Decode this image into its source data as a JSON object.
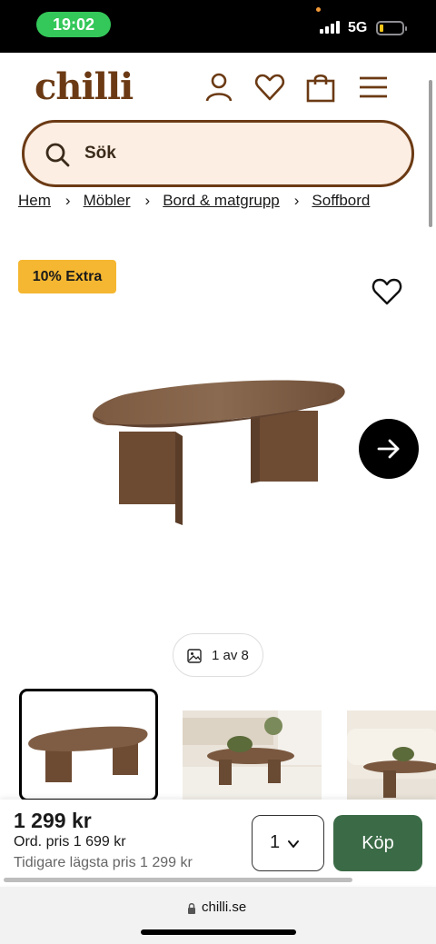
{
  "status_bar": {
    "time": "19:02",
    "network": "5G"
  },
  "header": {
    "logo": "chilli",
    "icons": [
      "user-icon",
      "heart-icon",
      "shopping-bag-icon",
      "hamburger-menu-icon"
    ]
  },
  "search": {
    "placeholder": "Sök"
  },
  "breadcrumb": [
    "Hem",
    "Möbler",
    "Bord & matgrupp",
    "Soffbord"
  ],
  "product": {
    "badge": "10% Extra",
    "image_counter": "1 av 8",
    "thumbnails": 3
  },
  "buy_bar": {
    "price": "1 299 kr",
    "ordinary_price": "Ord. pris 1 699 kr",
    "lowest_price": "Tidigare lägsta pris 1 299 kr",
    "quantity": "1",
    "buy_label": "Köp"
  },
  "browser": {
    "url": "chilli.se"
  },
  "colors": {
    "brand_brown": "#6b3a14",
    "search_bg": "#fdeee3",
    "badge_yellow": "#f5b731",
    "buy_green": "#3b6b46",
    "time_pill_green": "#34c759"
  }
}
